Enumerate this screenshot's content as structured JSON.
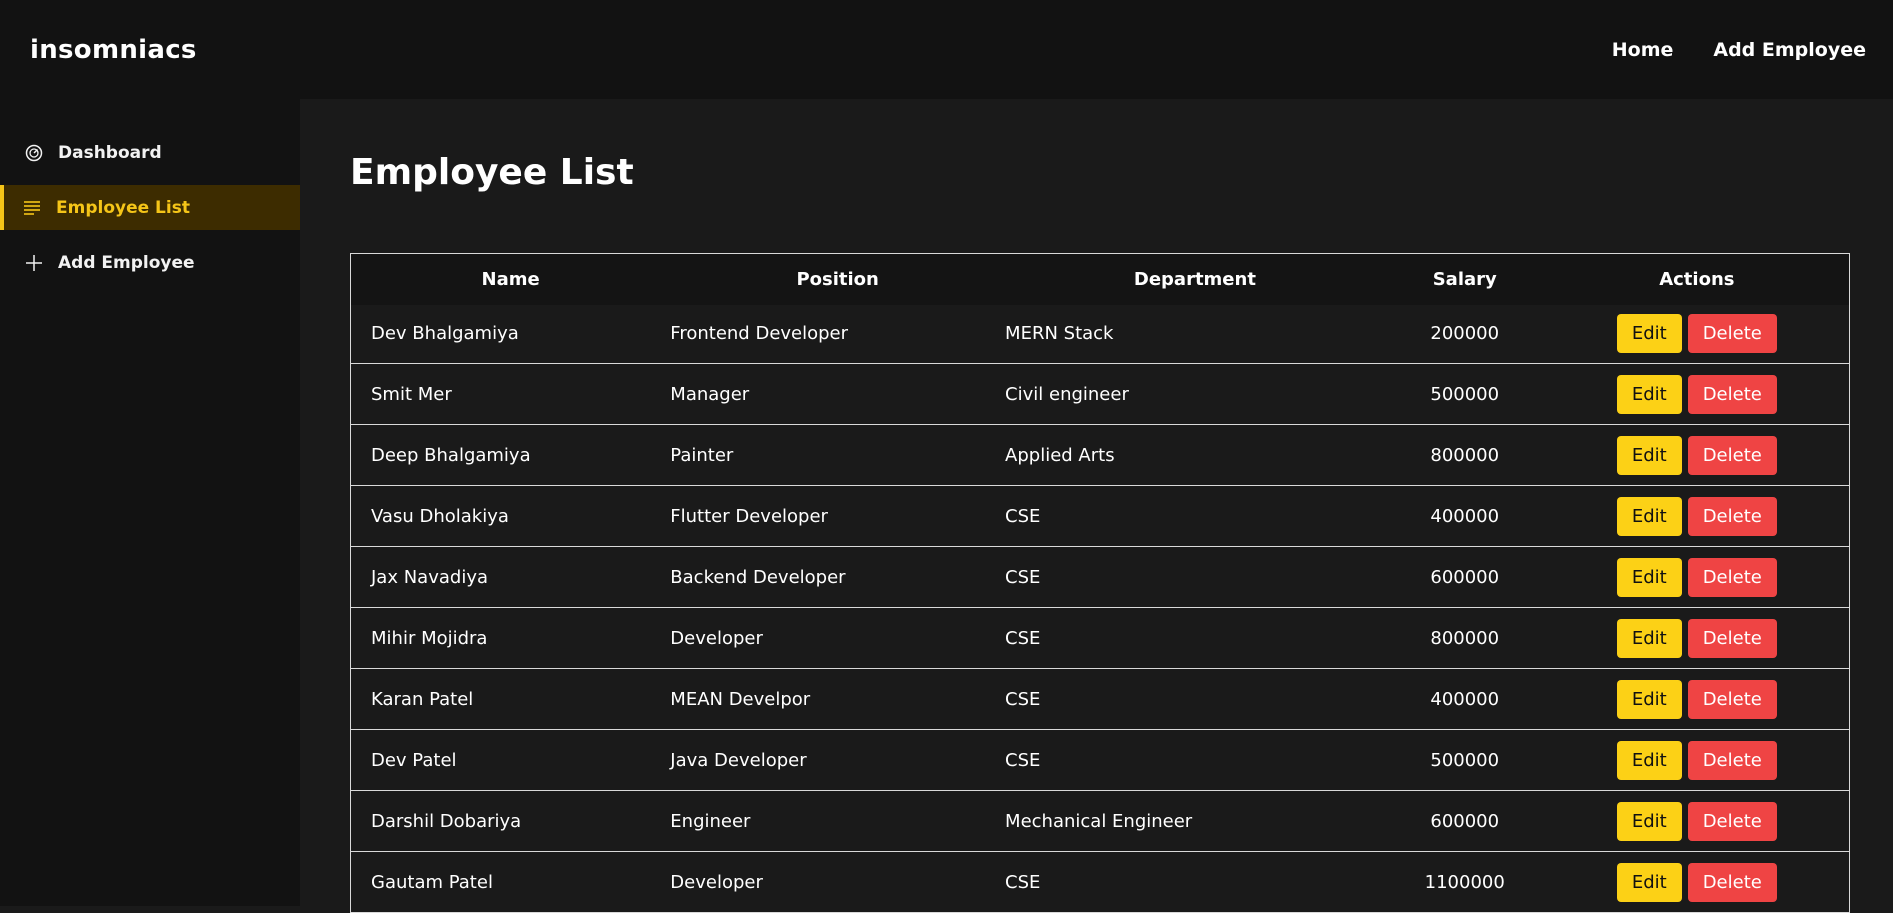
{
  "header": {
    "brand": "insomniacs",
    "nav": [
      {
        "label": "Home"
      },
      {
        "label": "Add Employee"
      }
    ]
  },
  "sidebar": {
    "items": [
      {
        "label": "Dashboard",
        "icon": "dashboard-icon",
        "active": false
      },
      {
        "label": "Employee List",
        "icon": "list-icon",
        "active": true
      },
      {
        "label": "Add Employee",
        "icon": "plus-icon",
        "active": false
      }
    ]
  },
  "main": {
    "title": "Employee List",
    "columns": [
      "Name",
      "Position",
      "Department",
      "Salary",
      "Actions"
    ],
    "edit_label": "Edit",
    "delete_label": "Delete",
    "rows": [
      {
        "name": "Dev Bhalgamiya",
        "position": "Frontend Developer",
        "department": "MERN Stack",
        "salary": "200000"
      },
      {
        "name": "Smit Mer",
        "position": "Manager",
        "department": "Civil engineer",
        "salary": "500000"
      },
      {
        "name": "Deep Bhalgamiya",
        "position": "Painter",
        "department": "Applied Arts",
        "salary": "800000"
      },
      {
        "name": "Vasu Dholakiya",
        "position": "Flutter Developer",
        "department": "CSE",
        "salary": "400000"
      },
      {
        "name": "Jax Navadiya",
        "position": "Backend Developer",
        "department": "CSE",
        "salary": "600000"
      },
      {
        "name": "Mihir Mojidra",
        "position": "Developer",
        "department": "CSE",
        "salary": "800000"
      },
      {
        "name": "Karan Patel",
        "position": "MEAN Develpor",
        "department": "CSE",
        "salary": "400000"
      },
      {
        "name": "Dev Patel",
        "position": "Java Developer",
        "department": "CSE",
        "salary": "500000"
      },
      {
        "name": "Darshil Dobariya",
        "position": "Engineer",
        "department": "Mechanical Engineer",
        "salary": "600000"
      },
      {
        "name": "Gautam Patel",
        "position": "Developer",
        "department": "CSE",
        "salary": "1100000"
      }
    ]
  },
  "colors": {
    "accent": "#f5c518",
    "edit": "#fcd116",
    "delete": "#ef4444",
    "active_bg": "#3d2c00"
  }
}
